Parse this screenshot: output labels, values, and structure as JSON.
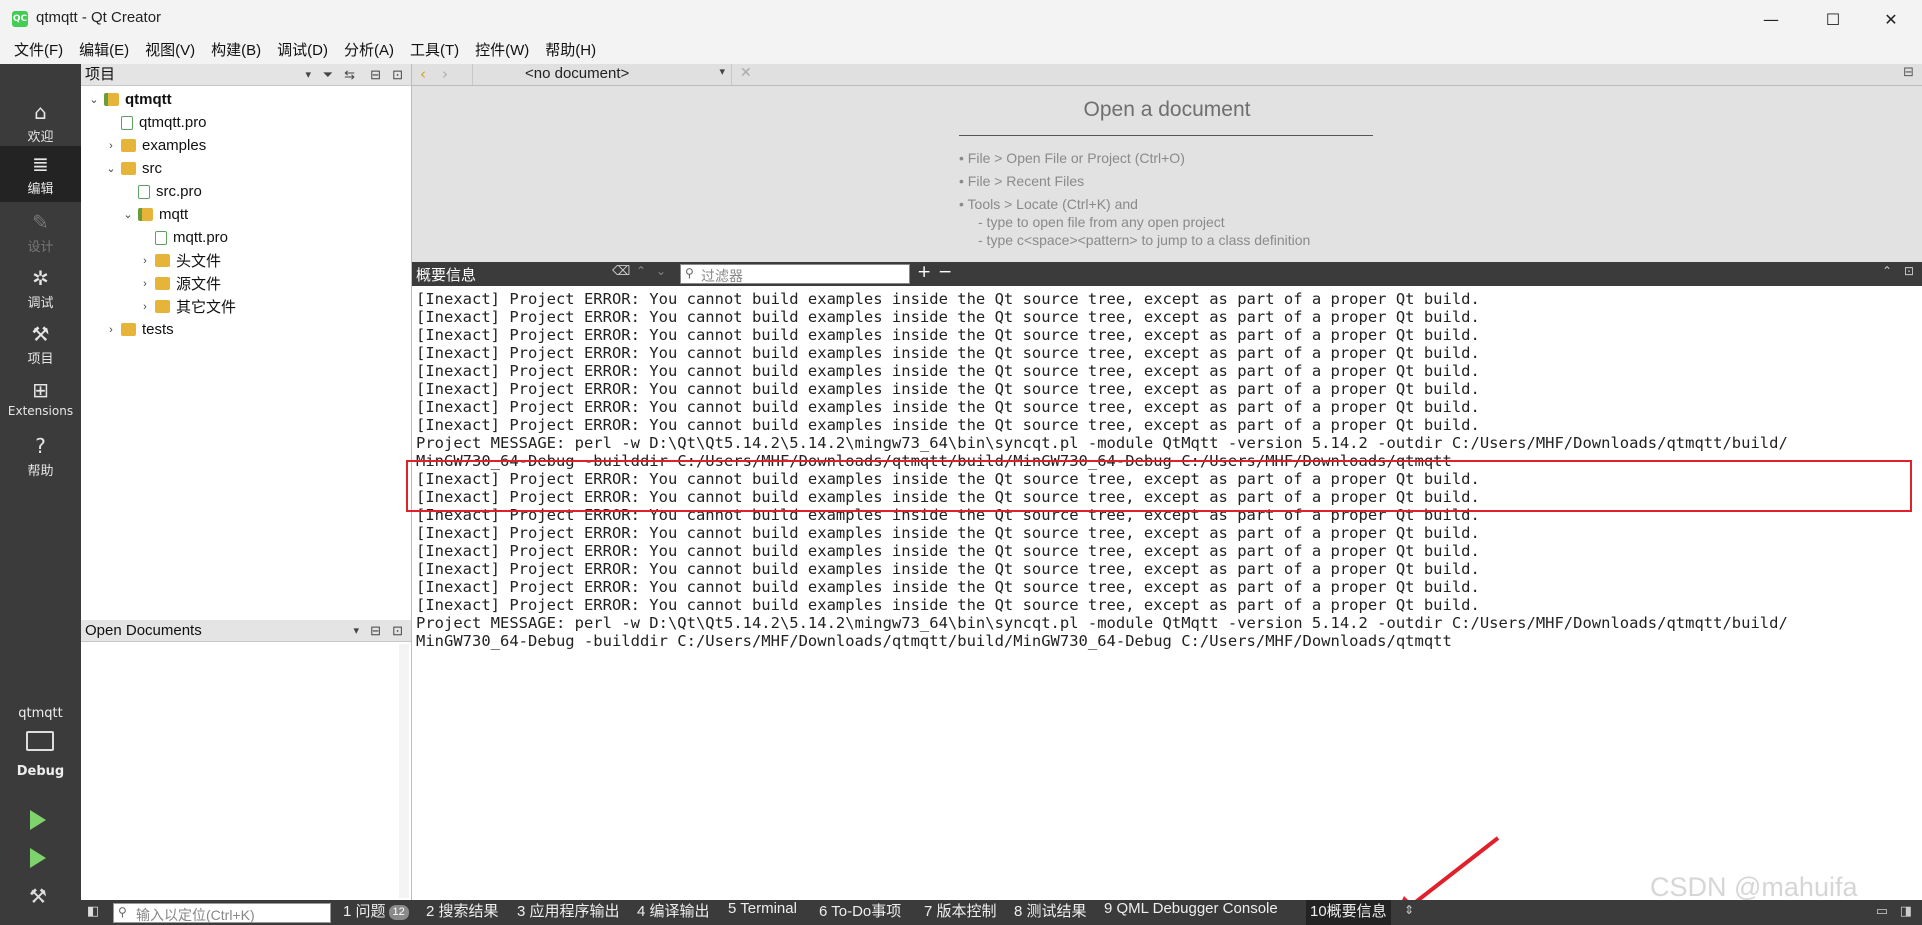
{
  "window": {
    "icon_text": "QC",
    "title": "qtmqtt - Qt Creator",
    "minimize": "—",
    "maximize": "☐",
    "close": "✕"
  },
  "menubar": [
    "文件(F)",
    "编辑(E)",
    "视图(V)",
    "构建(B)",
    "调试(D)",
    "分析(A)",
    "工具(T)",
    "控件(W)",
    "帮助(H)"
  ],
  "modes": [
    {
      "label": "欢迎",
      "icon": "home-icon"
    },
    {
      "label": "编辑",
      "icon": "edit-icon"
    },
    {
      "label": "设计",
      "icon": "design-icon"
    },
    {
      "label": "调试",
      "icon": "bug-icon"
    },
    {
      "label": "项目",
      "icon": "wrench-icon"
    },
    {
      "label": "Extensions",
      "icon": "extensions-icon"
    },
    {
      "label": "帮助",
      "icon": "help-icon"
    }
  ],
  "kit": {
    "project": "qtmqtt",
    "config": "Debug"
  },
  "projects_panel": {
    "title": "项目",
    "tree": [
      {
        "label": "qtmqtt",
        "indent": 0,
        "twisty": "⌄",
        "icon": "qt"
      },
      {
        "label": "qtmqtt.pro",
        "indent": 1,
        "twisty": "",
        "icon": "file"
      },
      {
        "label": "examples",
        "indent": 1,
        "twisty": "›",
        "icon": "folder"
      },
      {
        "label": "src",
        "indent": 1,
        "twisty": "⌄",
        "icon": "folder"
      },
      {
        "label": "src.pro",
        "indent": 2,
        "twisty": "",
        "icon": "file"
      },
      {
        "label": "mqtt",
        "indent": 2,
        "twisty": "⌄",
        "icon": "qt"
      },
      {
        "label": "mqtt.pro",
        "indent": 3,
        "twisty": "",
        "icon": "file"
      },
      {
        "label": "头文件",
        "indent": 3,
        "twisty": "›",
        "icon": "folder"
      },
      {
        "label": "源文件",
        "indent": 3,
        "twisty": "›",
        "icon": "folder"
      },
      {
        "label": "其它文件",
        "indent": 3,
        "twisty": "›",
        "icon": "folder"
      },
      {
        "label": "tests",
        "indent": 1,
        "twisty": "›",
        "icon": "folder"
      }
    ]
  },
  "open_documents": {
    "title": "Open Documents"
  },
  "editor": {
    "document_combo": "<no document>",
    "open_title": "Open a document",
    "hints": [
      "• File > Open File or Project (Ctrl+O)",
      "• File > Recent Files",
      "• Tools > Locate (Ctrl+K) and",
      "- type to open file from any open project",
      "- type c<space><pattern> to jump to a class definition"
    ]
  },
  "output": {
    "title": "概要信息",
    "filter_placeholder": "过滤器",
    "lines": [
      "[Inexact] Project ERROR: You cannot build examples inside the Qt source tree, except as part of a proper Qt build.",
      "[Inexact] Project ERROR: You cannot build examples inside the Qt source tree, except as part of a proper Qt build.",
      "[Inexact] Project ERROR: You cannot build examples inside the Qt source tree, except as part of a proper Qt build.",
      "[Inexact] Project ERROR: You cannot build examples inside the Qt source tree, except as part of a proper Qt build.",
      "[Inexact] Project ERROR: You cannot build examples inside the Qt source tree, except as part of a proper Qt build.",
      "[Inexact] Project ERROR: You cannot build examples inside the Qt source tree, except as part of a proper Qt build.",
      "[Inexact] Project ERROR: You cannot build examples inside the Qt source tree, except as part of a proper Qt build.",
      "[Inexact] Project ERROR: You cannot build examples inside the Qt source tree, except as part of a proper Qt build.",
      "Project MESSAGE: perl -w D:\\Qt\\Qt5.14.2\\5.14.2\\mingw73_64\\bin\\syncqt.pl -module QtMqtt -version 5.14.2 -outdir C:/Users/MHF/Downloads/qtmqtt/build/",
      "MinGW730_64-Debug -builddir C:/Users/MHF/Downloads/qtmqtt/build/MinGW730_64-Debug C:/Users/MHF/Downloads/qtmqtt",
      "[Inexact] Project ERROR: You cannot build examples inside the Qt source tree, except as part of a proper Qt build.",
      "[Inexact] Project ERROR: You cannot build examples inside the Qt source tree, except as part of a proper Qt build.",
      "[Inexact] Project ERROR: You cannot build examples inside the Qt source tree, except as part of a proper Qt build.",
      "[Inexact] Project ERROR: You cannot build examples inside the Qt source tree, except as part of a proper Qt build.",
      "[Inexact] Project ERROR: You cannot build examples inside the Qt source tree, except as part of a proper Qt build.",
      "[Inexact] Project ERROR: You cannot build examples inside the Qt source tree, except as part of a proper Qt build.",
      "[Inexact] Project ERROR: You cannot build examples inside the Qt source tree, except as part of a proper Qt build.",
      "[Inexact] Project ERROR: You cannot build examples inside the Qt source tree, except as part of a proper Qt build.",
      "Project MESSAGE: perl -w D:\\Qt\\Qt5.14.2\\5.14.2\\mingw73_64\\bin\\syncqt.pl -module QtMqtt -version 5.14.2 -outdir C:/Users/MHF/Downloads/qtmqtt/build/",
      "MinGW730_64-Debug -builddir C:/Users/MHF/Downloads/qtmqtt/build/MinGW730_64-Debug C:/Users/MHF/Downloads/qtmqtt"
    ]
  },
  "statusbar": {
    "locator_placeholder": "输入以定位(Ctrl+K)",
    "tabs": [
      {
        "label": "1 问题",
        "badge": "12"
      },
      {
        "label": "2 搜索结果"
      },
      {
        "label": "3 应用程序输出"
      },
      {
        "label": "4 编译输出"
      },
      {
        "label": "5 Terminal"
      },
      {
        "label": "6 To-Do事项"
      },
      {
        "label": "7 版本控制"
      },
      {
        "label": "8 测试结果"
      },
      {
        "label": "9 QML Debugger Console"
      },
      {
        "label": "10概要信息"
      }
    ]
  },
  "watermark": "CSDN @mahuifa",
  "colors": {
    "highlight_box": "#e0202a",
    "arrow": "#e0202a",
    "sidebar": "#3b3b3b"
  }
}
